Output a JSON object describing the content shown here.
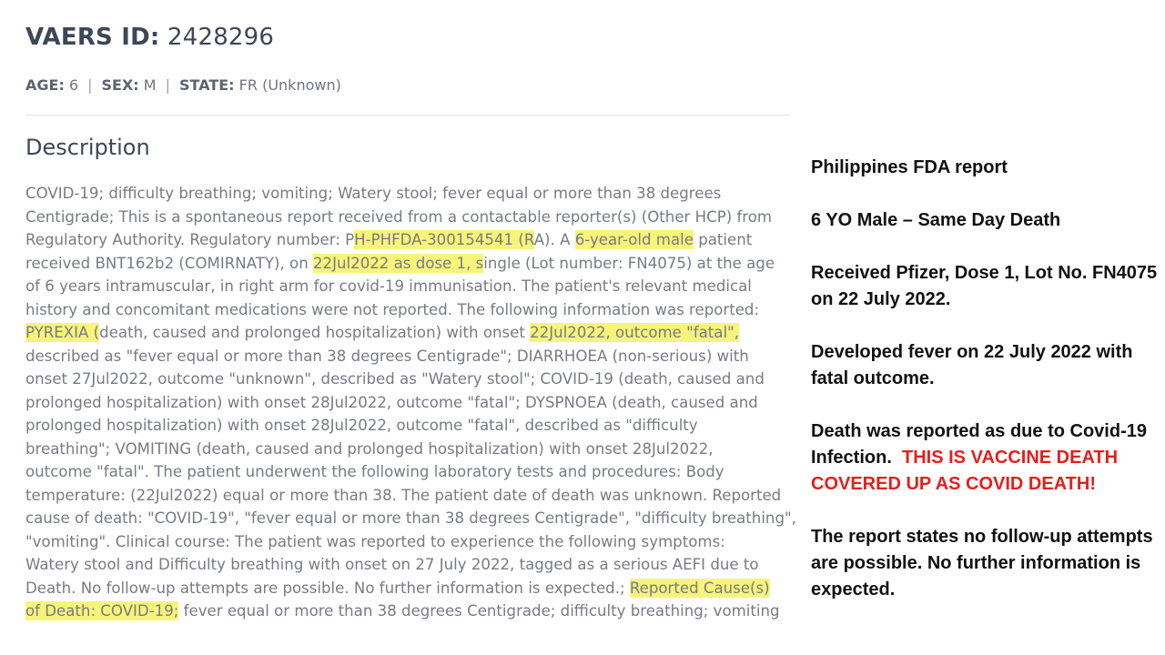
{
  "header": {
    "id_label": "VAERS ID:",
    "id_value": "2428296",
    "age_label": "AGE:",
    "age_value": "6",
    "sex_label": "SEX:",
    "sex_value": "M",
    "state_label": "STATE:",
    "state_value": "FR (Unknown)",
    "separator": "|"
  },
  "description": {
    "heading": "Description",
    "lines": [
      [
        {
          "t": "COVID-19; difficulty breathing; vomiting; Watery stool; fever equal or more than 38 degrees"
        }
      ],
      [
        {
          "t": "Centigrade; This is a spontaneous report received from a contactable reporter(s) (Other HCP) from"
        }
      ],
      [
        {
          "t": "Regulatory Authority. Regulatory number: P"
        },
        {
          "t": "H-PHFDA-300154541 (R",
          "hl": true
        },
        {
          "t": "A). A "
        },
        {
          "t": "6-year-old male",
          "hl": true
        },
        {
          "t": " patient"
        }
      ],
      [
        {
          "t": "received BNT162b2 (COMIRNATY), on "
        },
        {
          "t": "22Jul2022 as dose 1, s",
          "hl": true
        },
        {
          "t": "ingle (Lot number: FN4075) at the age"
        }
      ],
      [
        {
          "t": "of 6 years intramuscular, in right arm for covid-19 immunisation. The patient's relevant medical"
        }
      ],
      [
        {
          "t": "history and concomitant medications were not reported. The following information was reported:"
        }
      ],
      [
        {
          "t": "PYREXIA (",
          "hl": true
        },
        {
          "t": "death, caused and prolonged hospitalization) with onset "
        },
        {
          "t": "22Jul2022, outcome \"fatal\",",
          "hl": true
        }
      ],
      [
        {
          "t": "described as \"fever equal or more than 38 degrees Centigrade\"; DIARRHOEA (non-serious) with"
        }
      ],
      [
        {
          "t": "onset 27Jul2022, outcome \"unknown\", described as \"Watery stool\"; COVID-19 (death, caused and"
        }
      ],
      [
        {
          "t": "prolonged hospitalization) with onset 28Jul2022, outcome \"fatal\"; DYSPNOEA (death, caused and"
        }
      ],
      [
        {
          "t": "prolonged hospitalization) with onset 28Jul2022, outcome \"fatal\", described as \"difficulty"
        }
      ],
      [
        {
          "t": "breathing\"; VOMITING (death, caused and prolonged hospitalization) with onset 28Jul2022,"
        }
      ],
      [
        {
          "t": "outcome \"fatal\". The patient underwent the following laboratory tests and procedures: Body"
        }
      ],
      [
        {
          "t": "temperature: (22Jul2022) equal or more than 38. The patient date of death was unknown. Reported"
        }
      ],
      [
        {
          "t": "cause of death: \"COVID-19\", \"fever equal or more than 38 degrees Centigrade\", \"difficulty breathing\","
        }
      ],
      [
        {
          "t": "\"vomiting\". Clinical course: The patient was reported to experience the following symptoms:"
        }
      ],
      [
        {
          "t": "Watery stool and Difficulty breathing with onset on 27 July 2022, tagged as a serious AEFI due to"
        }
      ],
      [
        {
          "t": "Death. No follow-up attempts are possible. No further information is expected.; "
        },
        {
          "t": "Reported Cause(s)",
          "hl": true
        }
      ],
      [
        {
          "t": "of Death: COVID-19;",
          "hl": true
        },
        {
          "t": " fever equal or more than 38 degrees Centigrade; difficulty breathing; vomiting"
        }
      ]
    ]
  },
  "annotations": {
    "source": "Philippines FDA report",
    "summary": "6 YO Male – Same Day Death",
    "vaccine": "Received Pfizer, Dose 1, Lot No. FN4075 on 22 July 2022.",
    "fever": "Developed fever on 22 July 2022 with fatal outcome.",
    "death_reported": "Death was reported as due to Covid-19 Infection.",
    "claim": "THIS IS VACCINE DEATH COVERED UP AS COVID DEATH!",
    "followup": "The report states no follow-up attempts are possible. No further information is expected."
  },
  "colors": {
    "highlight": "#f8f47a",
    "claim_red": "#e3201c"
  }
}
